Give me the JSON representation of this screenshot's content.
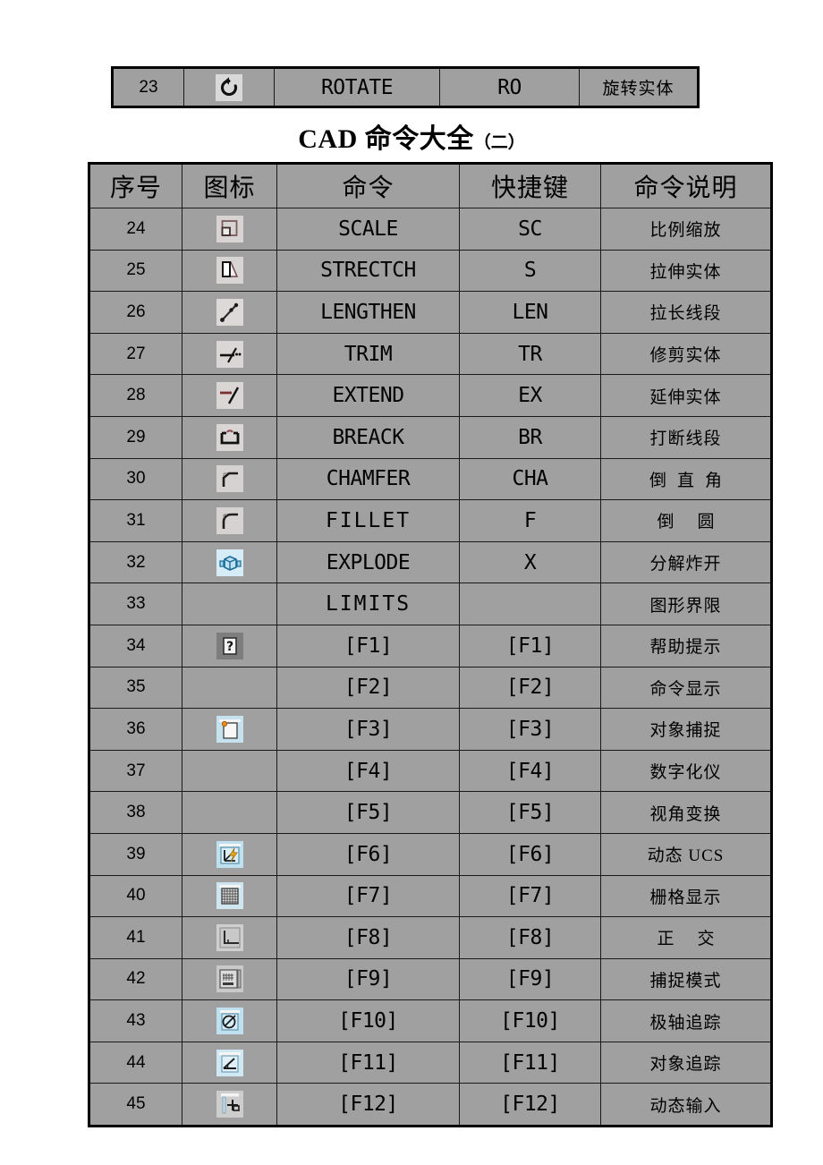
{
  "page": {
    "title_main": "CAD 命令大全",
    "title_suffix": "（二）",
    "background": "#ffffff",
    "cell_background": "#a0a0a0",
    "border_color": "#000000"
  },
  "top_table": {
    "rows": [
      {
        "no": "23",
        "icon": "rotate-icon",
        "command": "ROTATE",
        "shortcut": "RO",
        "description": "旋转实体"
      }
    ]
  },
  "main_table": {
    "headers": [
      "序号",
      "图标",
      "命令",
      "快捷键",
      "命令说明"
    ],
    "rows": [
      {
        "no": "24",
        "icon": "scale-icon",
        "command": "SCALE",
        "shortcut": "SC",
        "description": "比例缩放"
      },
      {
        "no": "25",
        "icon": "stretch-icon",
        "command": "STRECTCH",
        "shortcut": "S",
        "description": "拉伸实体"
      },
      {
        "no": "26",
        "icon": "lengthen-icon",
        "command": "LENGTHEN",
        "shortcut": "LEN",
        "description": "拉长线段"
      },
      {
        "no": "27",
        "icon": "trim-icon",
        "command": "TRIM",
        "shortcut": "TR",
        "description": "修剪实体"
      },
      {
        "no": "28",
        "icon": "extend-icon",
        "command": "EXTEND",
        "shortcut": "EX",
        "description": "延伸实体"
      },
      {
        "no": "29",
        "icon": "break-icon",
        "command": "BREACK",
        "shortcut": "BR",
        "description": "打断线段"
      },
      {
        "no": "30",
        "icon": "chamfer-icon",
        "command": "CHAMFER",
        "shortcut": "CHA",
        "description": "倒直角"
      },
      {
        "no": "31",
        "icon": "fillet-icon",
        "command": "FILLET",
        "shortcut": "F",
        "description": "倒圆"
      },
      {
        "no": "32",
        "icon": "explode-icon",
        "command": "EXPLODE",
        "shortcut": "X",
        "description": "分解炸开"
      },
      {
        "no": "33",
        "icon": "",
        "command": "LIMITS",
        "shortcut": "",
        "description": "图形界限"
      },
      {
        "no": "34",
        "icon": "help-icon",
        "command": "[F1]",
        "shortcut": "[F1]",
        "description": "帮助提示"
      },
      {
        "no": "35",
        "icon": "",
        "command": "[F2]",
        "shortcut": "[F2]",
        "description": "命令显示"
      },
      {
        "no": "36",
        "icon": "osnap-icon",
        "command": "[F3]",
        "shortcut": "[F3]",
        "description": "对象捕捉"
      },
      {
        "no": "37",
        "icon": "",
        "command": "[F4]",
        "shortcut": "[F4]",
        "description": "数字化仪"
      },
      {
        "no": "38",
        "icon": "",
        "command": "[F5]",
        "shortcut": "[F5]",
        "description": "视角变换"
      },
      {
        "no": "39",
        "icon": "dynamic-ucs-icon",
        "command": "[F6]",
        "shortcut": "[F6]",
        "description": "动态 UCS"
      },
      {
        "no": "40",
        "icon": "grid-icon",
        "command": "[F7]",
        "shortcut": "[F7]",
        "description": "栅格显示"
      },
      {
        "no": "41",
        "icon": "ortho-icon",
        "command": "[F8]",
        "shortcut": "[F8]",
        "description": "正交"
      },
      {
        "no": "42",
        "icon": "snap-icon",
        "command": "[F9]",
        "shortcut": "[F9]",
        "description": "捕捉模式"
      },
      {
        "no": "43",
        "icon": "polar-track-icon",
        "command": "[F10]",
        "shortcut": "[F10]",
        "description": "极轴追踪"
      },
      {
        "no": "44",
        "icon": "otrack-icon",
        "command": "[F11]",
        "shortcut": "[F11]",
        "description": "对象追踪"
      },
      {
        "no": "45",
        "icon": "dyninput-icon",
        "command": "[F12]",
        "shortcut": "[F12]",
        "description": "动态输入"
      }
    ]
  }
}
